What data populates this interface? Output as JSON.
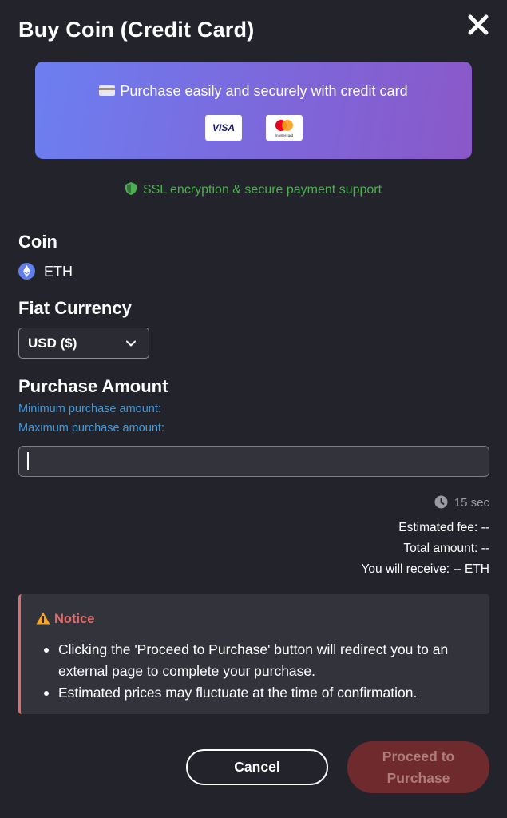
{
  "dialog": {
    "title": "Buy Coin (Credit Card)",
    "close_icon": "close-icon"
  },
  "banner": {
    "text": "Purchase easily and securely with credit card",
    "card_icon": "credit-card-icon",
    "visa_label": "VISA",
    "mastercard_label": "mastercard"
  },
  "security": {
    "text": "SSL encryption & secure payment support",
    "icon": "shield-icon"
  },
  "coin": {
    "label": "Coin",
    "value": "ETH",
    "icon": "eth-icon"
  },
  "fiat": {
    "label": "Fiat Currency",
    "selected": "USD ($)",
    "icon": "chevron-down-icon"
  },
  "purchase": {
    "label": "Purchase Amount",
    "min_label": "Minimum purchase amount:",
    "max_label": "Maximum purchase amount:",
    "input_value": ""
  },
  "quote": {
    "timer": "15 sec",
    "timer_icon": "clock-icon",
    "estimated_fee": "Estimated fee: --",
    "total_amount": "Total amount: --",
    "you_receive": "You will receive: -- ETH"
  },
  "notice": {
    "title": "Notice",
    "icon": "warning-icon",
    "items": [
      "Clicking the 'Proceed to Purchase' button will redirect you to an external page to complete your purchase.",
      "Estimated prices may fluctuate at the time of confirmation."
    ]
  },
  "actions": {
    "cancel_label": "Cancel",
    "proceed_label": "Proceed to Purchase"
  },
  "colors": {
    "background": "#22232b",
    "security_green": "#4caf50",
    "hint_blue": "#3d9be0",
    "notice_red": "#e26a6a",
    "proceed_disabled": "#6e2a2c"
  }
}
